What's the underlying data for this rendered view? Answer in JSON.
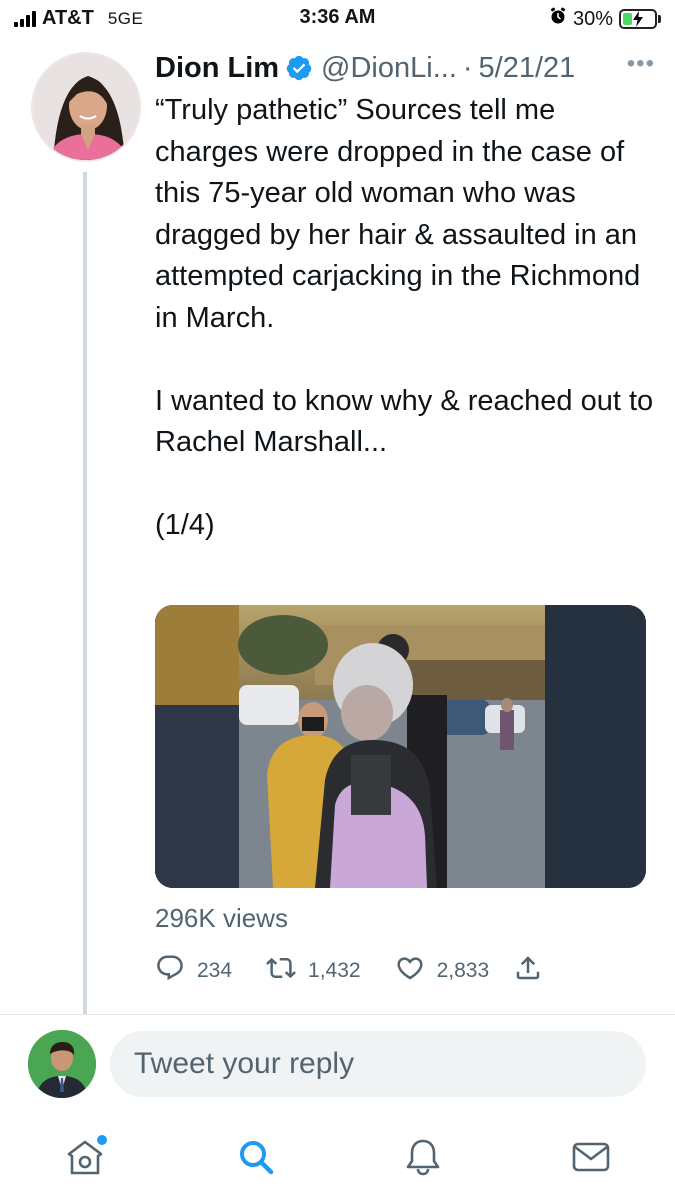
{
  "status_bar": {
    "carrier": "AT&T",
    "network": "5GE",
    "time": "3:36 AM",
    "battery": "30%",
    "battery_level": 0.3
  },
  "tweet": {
    "display_name": "Dion Lim",
    "verified": true,
    "handle": "@DionLi...",
    "separator": "·",
    "date": "5/21/21",
    "more_label": "•••",
    "text": "“Truly pathetic” Sources tell me charges were dropped in the case of this 75-year old woman who was dragged by her hair & assaulted in an attempted carjacking in the Richmond in March.\n\nI wanted to know why & reached out to Rachel Marshall...\n\n(1/4)",
    "views": "296K views",
    "actions": {
      "replies": "234",
      "retweets": "1,432",
      "likes": "2,833"
    }
  },
  "reply": {
    "placeholder": "Tweet your reply"
  },
  "tab_bar": {
    "items": [
      "home-icon",
      "search-icon",
      "bell-icon",
      "mail-icon"
    ],
    "active": "search-icon"
  },
  "colors": {
    "accent": "#1d9bf0",
    "muted": "#536471",
    "thread_line": "#cfd9de",
    "battery_fill": "#4cd964"
  }
}
